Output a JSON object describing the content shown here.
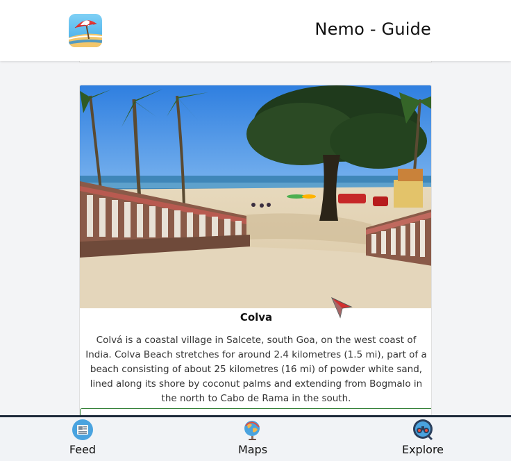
{
  "header": {
    "title": "Nemo - Guide",
    "logo_icon": "beach-umbrella-icon"
  },
  "card": {
    "title": "Colva",
    "description": "Colvá is a coastal village in Salcete, south Goa, on the west coast of India. Colva Beach stretches for around 2.4 kilometres (1.5 mi), part of a beach consisting of about 25 kilometres (16 mi) of powder white sand, lined along its shore by coconut palms and extending from Bogmalo in the north to Cabo de Rama in the south.",
    "image_icon": "beach-photo"
  },
  "bottom_nav": {
    "items": [
      {
        "label": "Feed",
        "icon": "newspaper-icon"
      },
      {
        "label": "Maps",
        "icon": "globe-map-icon"
      },
      {
        "label": "Explore",
        "icon": "binoculars-icon"
      }
    ]
  },
  "colors": {
    "nav_border": "#1d2a3a",
    "action_border": "#2e7d32",
    "page_bg": "#f3f4f6"
  }
}
